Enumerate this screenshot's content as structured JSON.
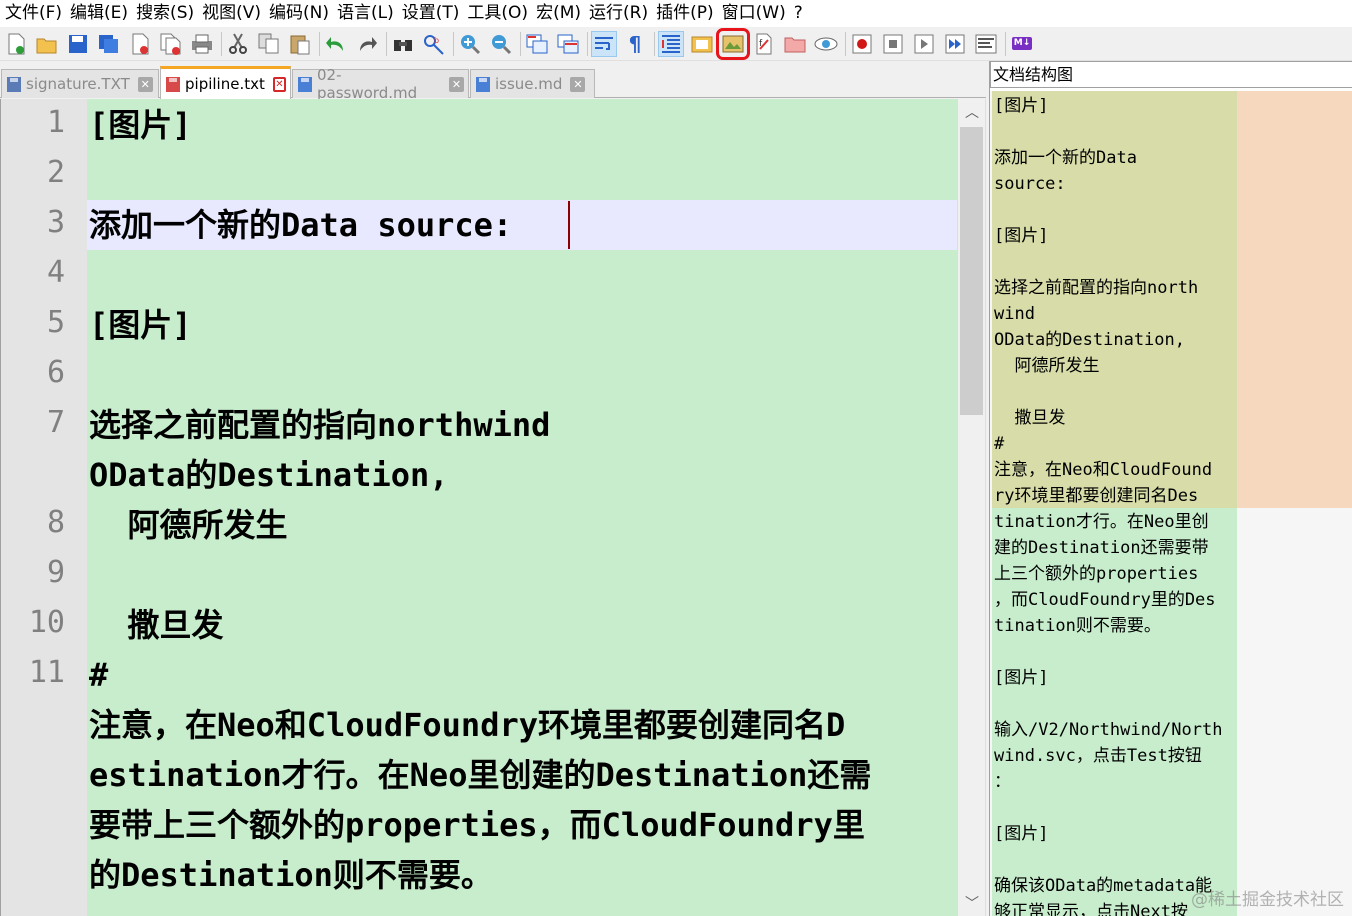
{
  "menu": [
    "文件(F)",
    "编辑(E)",
    "搜索(S)",
    "视图(V)",
    "编码(N)",
    "语言(L)",
    "设置(T)",
    "工具(O)",
    "宏(M)",
    "运行(R)",
    "插件(P)",
    "窗口(W)",
    "?"
  ],
  "toolbar": {
    "icons": [
      "new-file-icon",
      "open-file-icon",
      "save-icon",
      "save-all-icon",
      "close-icon",
      "close-all-icon",
      "print-icon",
      "cut-icon",
      "copy-icon",
      "paste-icon",
      "undo-icon",
      "redo-icon",
      "find-icon",
      "replace-icon",
      "zoom-in-icon",
      "zoom-out-icon",
      "sync-vertical-icon",
      "sync-horizontal-icon",
      "word-wrap-icon",
      "show-all-chars-icon",
      "indent-guide-icon",
      "user-language-icon",
      "document-map-icon",
      "function-list-icon",
      "folder-workspace-icon",
      "monitor-icon",
      "record-macro-icon",
      "stop-record-icon",
      "play-macro-icon",
      "run-macro-multiple-icon",
      "save-macro-icon",
      "markdown-icon"
    ],
    "markdown_label": "M↓"
  },
  "tabs": [
    {
      "label": "signature.TXT",
      "active": false
    },
    {
      "label": "pipiline.txt",
      "active": true
    },
    {
      "label": "02-password.md",
      "active": false
    },
    {
      "label": "issue.md",
      "active": false
    }
  ],
  "editor": {
    "line_numbers": [
      "1",
      "2",
      "3",
      "4",
      "5",
      "6",
      "7",
      "8",
      "9",
      "10",
      "11"
    ],
    "lines": [
      "[图片]",
      "",
      "添加一个新的Data source:",
      "",
      "[图片]",
      "",
      "选择之前配置的指向northwind",
      "OData的Destination,",
      "  阿德所发生",
      "",
      "  撒旦发",
      "#",
      "注意，在Neo和CloudFoundry环境里都要创建同名D",
      "estination才行。在Neo里创建的Destination还需",
      "要带上三个额外的properties，而CloudFoundry里",
      "的Destination则不需要。"
    ]
  },
  "panel": {
    "title": "文档结构图",
    "lines": [
      "[图片]",
      "",
      "添加一个新的Data",
      "source:",
      "",
      "[图片]",
      "",
      "选择之前配置的指向north",
      "wind",
      "OData的Destination,",
      "  阿德所发生",
      "",
      "  撒旦发",
      "#",
      "注意，在Neo和CloudFound",
      "ry环境里都要创建同名Des",
      "tination才行。在Neo里创",
      "建的Destination还需要带",
      "上三个额外的properties",
      "，而CloudFoundry里的Des",
      "tination则不需要。",
      "",
      "[图片]",
      "",
      "输入/V2/Northwind/North",
      "wind.svc，点击Test按钮",
      "：",
      "",
      "[图片]",
      "",
      "确保该OData的metadata能",
      "够正常显示，点击Next按"
    ]
  },
  "watermark": "@稀土掘金技术社区",
  "colors": {
    "editor_bg": "#c7edcc",
    "current_line": "#e8e8ff",
    "highlight_ring": "#e8141b",
    "active_tab_accent": "#f5a623"
  }
}
